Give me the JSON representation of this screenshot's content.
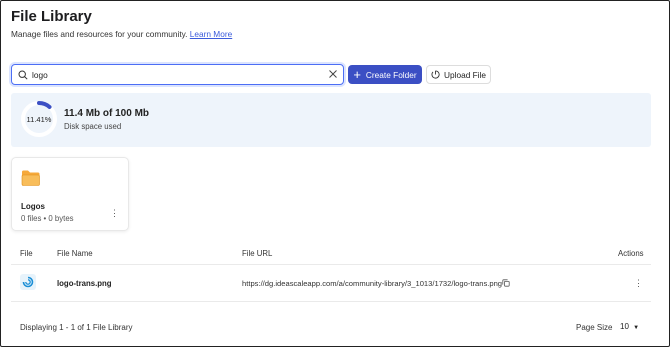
{
  "header": {
    "title": "File Library",
    "subtitle": "Manage files and resources for your community.",
    "learn_more": "Learn More"
  },
  "search": {
    "value": "logo",
    "placeholder": ""
  },
  "toolbar": {
    "create_folder": "Create Folder",
    "upload_file": "Upload File"
  },
  "storage": {
    "percent_label": "11.41%",
    "percent_value": 11.41,
    "used": "11.4 Mb of 100 Mb",
    "label": "Disk space used",
    "accent_color": "#3b4fc4"
  },
  "folders": [
    {
      "name": "Logos",
      "meta": "0 files • 0 bytes",
      "icon": "folder-icon",
      "color": "#f6a93b"
    }
  ],
  "table": {
    "columns": [
      "File",
      "File Name",
      "File URL",
      "Actions"
    ],
    "rows": [
      {
        "icon": "file-thumbnail-icon",
        "name": "logo-trans.png",
        "url": "https://dg.ideascaleapp.com/a/community-library/3_1013/1732/logo-trans.png"
      }
    ]
  },
  "footer": {
    "displaying": "Displaying 1 - 1 of 1 File Library",
    "page_size_label": "Page Size",
    "page_size_value": "10"
  }
}
